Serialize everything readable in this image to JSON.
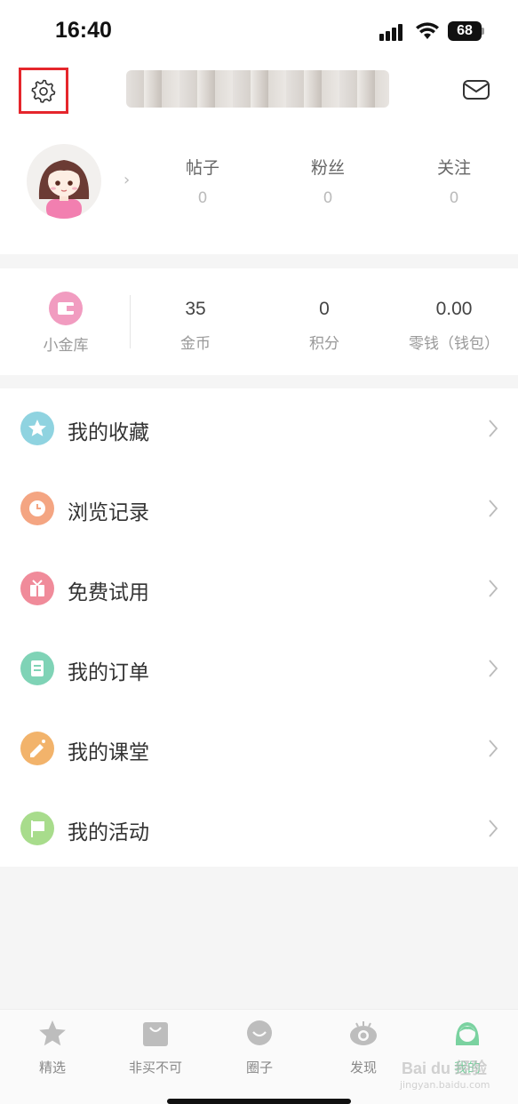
{
  "status_bar": {
    "time": "16:40",
    "battery": "68"
  },
  "profile": {
    "stats": [
      {
        "label": "帖子",
        "value": "0"
      },
      {
        "label": "粉丝",
        "value": "0"
      },
      {
        "label": "关注",
        "value": "0"
      }
    ]
  },
  "wallet": {
    "vault_label": "小金库",
    "items": [
      {
        "value": "35",
        "label": "金币"
      },
      {
        "value": "0",
        "label": "积分"
      },
      {
        "value": "0.00",
        "label": "零钱（钱包）"
      }
    ]
  },
  "menu": [
    {
      "label": "我的收藏",
      "icon": "star-icon",
      "color": "#8fd3e0"
    },
    {
      "label": "浏览记录",
      "icon": "clock-icon",
      "color": "#f4a582"
    },
    {
      "label": "免费试用",
      "icon": "gift-icon",
      "color": "#f08b9a"
    },
    {
      "label": "我的订单",
      "icon": "document-icon",
      "color": "#7fd3b6"
    },
    {
      "label": "我的课堂",
      "icon": "pencil-icon",
      "color": "#f2b36b"
    },
    {
      "label": "我的活动",
      "icon": "flag-icon",
      "color": "#a8dc8c"
    }
  ],
  "tabs": [
    {
      "label": "精选",
      "icon": "star-icon"
    },
    {
      "label": "非买不可",
      "icon": "bag-icon"
    },
    {
      "label": "圈子",
      "icon": "chat-bubble-icon"
    },
    {
      "label": "发现",
      "icon": "eye-icon"
    },
    {
      "label": "我的",
      "icon": "profile-icon",
      "active": true
    }
  ],
  "watermark": {
    "text": "Bai du 经验",
    "sub": "jingyan.baidu.com"
  },
  "colors": {
    "accent": "#7ad2a0",
    "highlight_border": "#e5262c"
  }
}
